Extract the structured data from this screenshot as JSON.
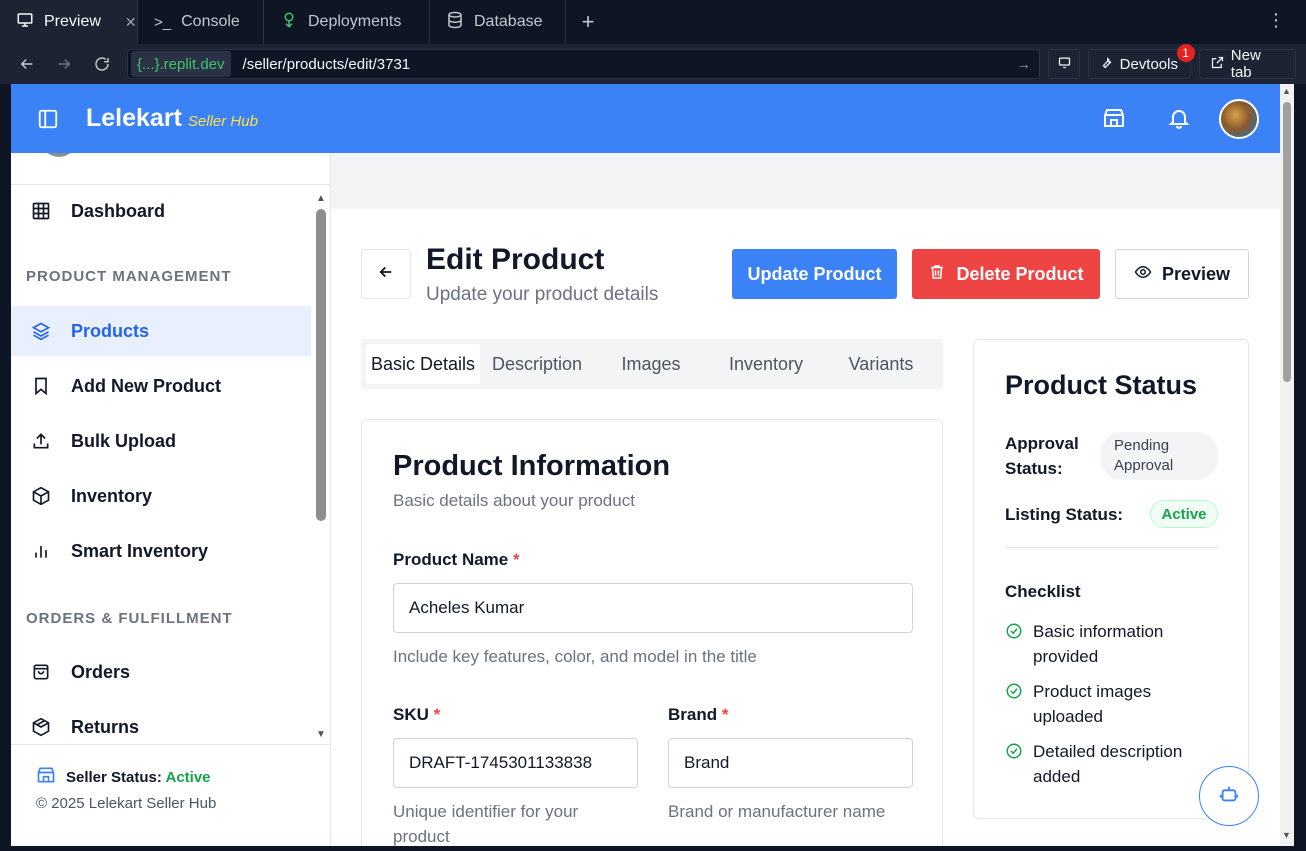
{
  "chrome": {
    "tabs": [
      {
        "label": "Preview",
        "active": true,
        "icon": "monitor-icon"
      },
      {
        "label": "Console",
        "icon": "terminal-icon"
      },
      {
        "label": "Deployments",
        "icon": "deploy-icon"
      },
      {
        "label": "Database",
        "icon": "database-icon"
      }
    ],
    "url_domain": "{...}.replit.dev",
    "url_path": "/seller/products/edit/3731",
    "devtools_label": "Devtools",
    "devtools_badge": "1",
    "newtab_label": "New tab"
  },
  "header": {
    "brand": "Lelekart",
    "brand_sub": "Seller Hub"
  },
  "sidebar": {
    "dashboard": "Dashboard",
    "section_product": "PRODUCT MANAGEMENT",
    "products": "Products",
    "add_new": "Add New Product",
    "bulk_upload": "Bulk Upload",
    "inventory": "Inventory",
    "smart_inventory": "Smart Inventory",
    "section_orders": "ORDERS & FULFILLMENT",
    "orders": "Orders",
    "returns": "Returns",
    "seller_status_label": "Seller Status:",
    "seller_status_value": "Active",
    "copyright": "© 2025 Lelekart Seller Hub"
  },
  "page": {
    "title": "Edit Product",
    "subtitle": "Update your product details",
    "update_btn": "Update Product",
    "delete_btn": "Delete Product",
    "preview_btn": "Preview",
    "tabs": [
      "Basic Details",
      "Description",
      "Images",
      "Inventory",
      "Variants"
    ]
  },
  "form": {
    "title": "Product Information",
    "subtitle": "Basic details about your product",
    "product_name_label": "Product Name",
    "product_name_value": "Acheles Kumar",
    "product_name_hint": "Include key features, color, and model in the title",
    "sku_label": "SKU",
    "sku_value": "DRAFT-1745301133838",
    "sku_hint": "Unique identifier for your product",
    "brand_label": "Brand",
    "brand_value": "Brand",
    "brand_hint": "Brand or manufacturer name",
    "required_mark": "*"
  },
  "status": {
    "title": "Product Status",
    "approval_label": "Approval Status:",
    "approval_value": "Pending Approval",
    "listing_label": "Listing Status:",
    "listing_value": "Active",
    "checklist_title": "Checklist",
    "checklist": [
      "Basic information provided",
      "Product images uploaded",
      "Detailed description added"
    ]
  },
  "colors": {
    "primary": "#3b82f6",
    "danger": "#ef4444",
    "success": "#16a34a",
    "brand_accent": "#fde047"
  }
}
